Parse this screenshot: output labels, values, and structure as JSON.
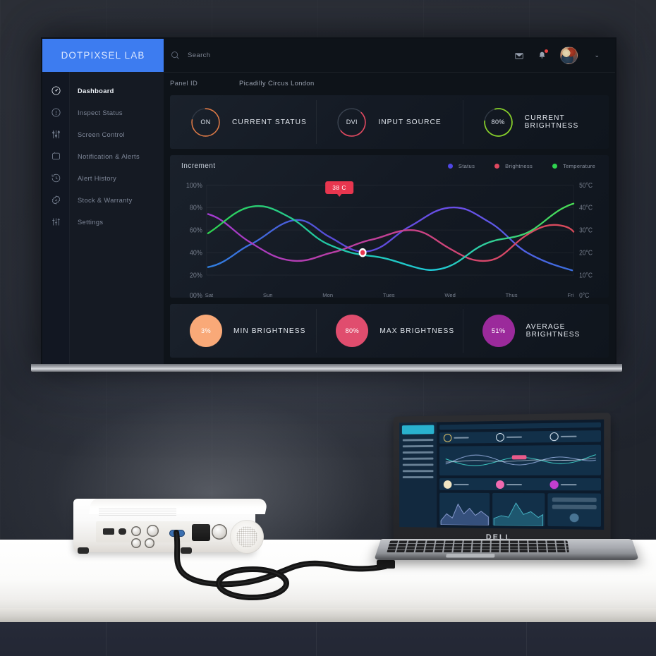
{
  "app": {
    "brand": "DOTPIXSEL LAB"
  },
  "search": {
    "placeholder": "Search",
    "value": "",
    "icon": "search-icon"
  },
  "topbar": {
    "mail_icon": "mail-icon",
    "bell_icon": "bell-icon",
    "notification_badge": "",
    "avatar": "avatar",
    "chevron": "⌄"
  },
  "sidebar": {
    "items": [
      {
        "label": "Dashboard",
        "icon": "gauge-icon",
        "active": true
      },
      {
        "label": "Inspect Status",
        "icon": "info-circle-icon",
        "active": false
      },
      {
        "label": "Screen Control",
        "icon": "sliders-icon",
        "active": false
      },
      {
        "label": "Notification & Alerts",
        "icon": "bell-box-icon",
        "active": false
      },
      {
        "label": "Alert History",
        "icon": "history-icon",
        "active": false
      },
      {
        "label": "Stock & Warranty",
        "icon": "badge-icon",
        "active": false
      },
      {
        "label": "Settings",
        "icon": "equalizer-icon",
        "active": false
      }
    ]
  },
  "panel_info": {
    "key": "Panel ID",
    "value": "Picadilly Circus London"
  },
  "stats": [
    {
      "value": "ON",
      "label": "CURRENT STATUS",
      "color": "#e07a45",
      "pct": 78
    },
    {
      "value": "DVI",
      "label": "INPUT SOURCE",
      "color": "#e0485f",
      "pct": 55
    },
    {
      "value": "80%",
      "label": "CURRENT BRIGHTNESS",
      "color": "#88d12a",
      "pct": 80
    }
  ],
  "chart_card": {
    "title": "Increment",
    "legend": [
      {
        "label": "Status",
        "color": "#4f46e5"
      },
      {
        "label": "Brightness",
        "color": "#e0485f"
      },
      {
        "label": "Temperature",
        "color": "#2fd44f"
      }
    ],
    "tooltip": {
      "text": "38 C",
      "color": "#e8364f"
    }
  },
  "chart_data": {
    "type": "line",
    "title": "Increment",
    "x": [
      "Sat",
      "Sun",
      "Mon",
      "Tues",
      "Wed",
      "Thus",
      "Fri"
    ],
    "xlabel": "",
    "ylabel_left": "",
    "ylabel_right": "",
    "ytick_labels_left": [
      "100%",
      "80%",
      "60%",
      "40%",
      "20%",
      "00%"
    ],
    "ytick_labels_right": [
      "50°C",
      "40°C",
      "30°C",
      "20°C",
      "10°C",
      "0°C"
    ],
    "ylim_left": [
      0,
      100
    ],
    "ylim_right": [
      0,
      50
    ],
    "grid": true,
    "legend_position": "top-right",
    "annotations": [
      {
        "text": "38 C",
        "x": "Mon",
        "y": 55,
        "color": "#e8364f"
      }
    ],
    "series": [
      {
        "name": "Status",
        "color": "#4f46e5",
        "values": [
          22,
          33,
          62,
          72,
          44,
          66,
          78,
          60,
          33,
          22,
          44,
          70,
          80,
          74,
          52,
          30,
          20
        ]
      },
      {
        "name": "Brightness",
        "color": "#e0485f",
        "values": [
          82,
          76,
          62,
          48,
          40,
          38,
          44,
          56,
          66,
          70,
          62,
          44,
          34,
          32,
          44,
          62,
          56
        ]
      },
      {
        "name": "Temperature",
        "color": "#2fd44f",
        "values": [
          62,
          74,
          80,
          74,
          60,
          48,
          42,
          36,
          28,
          24,
          30,
          46,
          56,
          52,
          42,
          58,
          78
        ]
      }
    ]
  },
  "brightness": [
    {
      "value": "3%",
      "label": "MIN BRIGHTNESS",
      "color": "#f9a978"
    },
    {
      "value": "80%",
      "label": "MAX BRIGHTNESS",
      "color": "#e04d6e"
    },
    {
      "value": "51%",
      "label": "AVERAGE BRIGHTNESS",
      "color": "#9b2a9b"
    }
  ],
  "laptop": {
    "brand": "DELL"
  }
}
